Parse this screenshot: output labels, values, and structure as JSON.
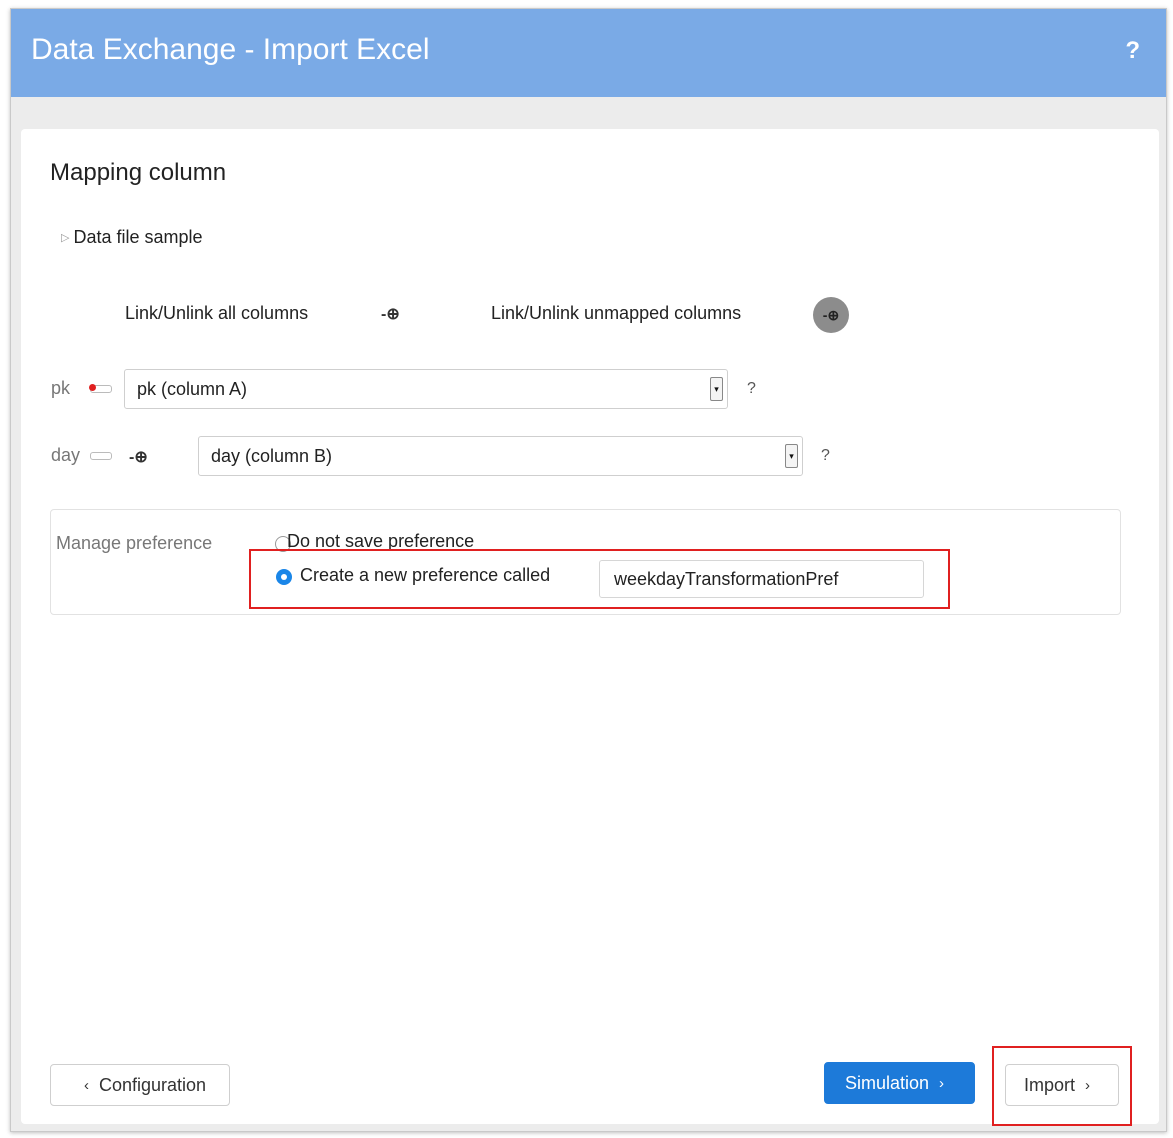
{
  "header": {
    "title": "Data Exchange - Import Excel",
    "help": "?"
  },
  "section": {
    "title": "Mapping column",
    "sample_toggle": "Data file sample"
  },
  "links": {
    "all_label": "Link/Unlink all columns",
    "unmapped_label": "Link/Unlink unmapped columns",
    "plug_glyph": "-⊕"
  },
  "fields": [
    {
      "label": "pk",
      "value": "pk (column A)",
      "help": "?",
      "key_icon": "primary-key-icon"
    },
    {
      "label": "day",
      "value": "day (column B)",
      "help": "?",
      "key_icon": "key-icon"
    }
  ],
  "preference": {
    "label": "Manage preference",
    "option_no_save": "Do not save preference",
    "option_create": "Create a new preference called",
    "name_value": "weekdayTransformationPref",
    "selected": "create"
  },
  "footer": {
    "configuration": "Configuration",
    "simulation": "Simulation",
    "import": "Import",
    "chevron_left": "‹",
    "chevron_right": "›"
  },
  "colors": {
    "header_bg": "#7aaae6",
    "primary": "#1d7ad9",
    "highlight": "#e02020"
  }
}
